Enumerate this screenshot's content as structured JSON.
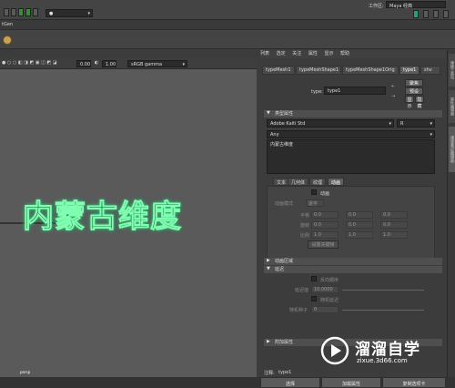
{
  "topbar": {
    "workspace_label": "工作区:",
    "workspace_value": "Maya 经典",
    "left_dropdown_value": ""
  },
  "secondbar": {
    "label": "tGen"
  },
  "viewport_toolbar": {
    "field_a": "0.00",
    "field_b": "1.00",
    "color_space": "sRGB gamma"
  },
  "viewport": {
    "text": "内蒙古维度",
    "camera_label": "persp"
  },
  "attr_editor": {
    "menu": [
      "列表",
      "选定",
      "关注",
      "属性",
      "显示",
      "帮助"
    ],
    "tabs": [
      "typeMesh1",
      "typeMeshShape1",
      "typeMeshShape1Orig",
      "type1",
      "shv"
    ],
    "active_tab_index": 3,
    "type_label": "type:",
    "type_value": "type1",
    "buttons": {
      "focus": "聚焦",
      "presets": "预设",
      "show": "显示",
      "hide": "隐藏"
    },
    "font_section_title": "类型属性",
    "font_value": "Adobe Kaiti Std",
    "font_style_value": "R",
    "writing_system": "Any",
    "text_value": "内蒙古维度",
    "subtabs": [
      "文本",
      "几何体",
      "纹理",
      "动画"
    ],
    "active_subtab_index": 3,
    "animate_label": "动画",
    "anim_mode_label": "动画模式",
    "anim_mode_value": "逐字",
    "translate_label": "平移",
    "rotate_label": "旋转",
    "scale_label": "比例",
    "translate_values": [
      "0.0",
      "0.0",
      "0.0"
    ],
    "rotate_values": [
      "0.0",
      "0.0",
      "0.0"
    ],
    "scale_values": [
      "1.0",
      "1.0",
      "1.0"
    ],
    "set_keyframe_button": "设置关键帧",
    "section_anim_area": "动画区域",
    "section_delay": "延迟",
    "reverse_label": "反向顺序",
    "delay_label": "延迟值",
    "delay_value": "10.0000",
    "random_delay_label": "随机延迟",
    "random_seed_label": "随机种子",
    "random_seed_value": "0",
    "section_extra": "附加属性",
    "notes_label": "注释:",
    "notes_value": "type1"
  },
  "footer_buttons": {
    "select": "选择",
    "load_attrs": "加载属性",
    "copy_tab": "复制选项卡"
  },
  "right_vertical_tabs": [
    "建模工具包",
    "属性编辑器",
    "通道盒/层编辑器"
  ],
  "watermark": {
    "brand": "溜溜自学",
    "url": "zixue.3d66.com"
  }
}
